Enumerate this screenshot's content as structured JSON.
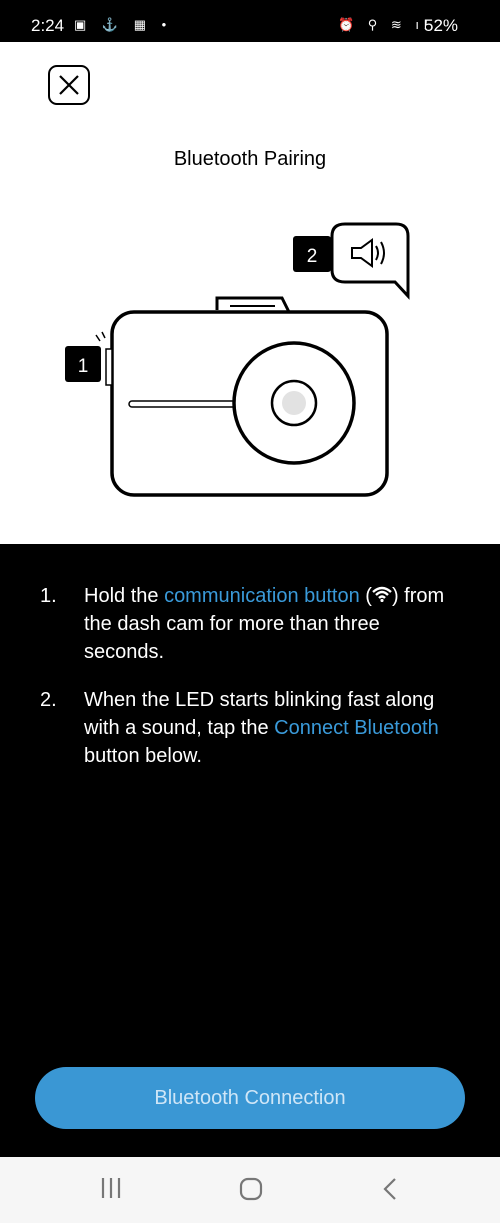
{
  "status_bar": {
    "time": "2:24",
    "left_icons": "gallery-icon, person-icon, calendar-19-icon, dot",
    "battery": "52%"
  },
  "header": {
    "title": "Bluetooth Pairing"
  },
  "illustration": {
    "label_1": "1",
    "label_2": "2"
  },
  "steps": [
    {
      "num": "1.",
      "pre": "Hold the ",
      "link": "communication button",
      "post_icon": "wifi-icon",
      "post": " from the dash cam for more than three seconds.",
      "open": " (",
      "close": ")"
    },
    {
      "num": "2.",
      "pre": "When the LED starts blinking fast along with a sound, tap the ",
      "link": "Connect Bluetooth",
      "post": " button below."
    }
  ],
  "button": {
    "label": "Bluetooth Connection"
  },
  "colors": {
    "accent": "#3a97d4",
    "link": "#3a9ad9"
  }
}
